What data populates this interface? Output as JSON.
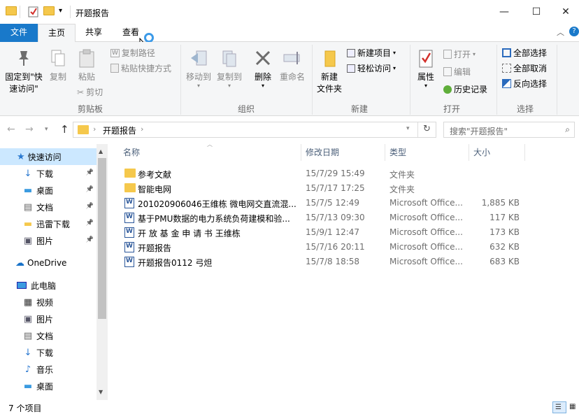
{
  "window": {
    "title": "开题报告"
  },
  "tabs": {
    "file": "文件",
    "home": "主页",
    "share": "共享",
    "view": "查看"
  },
  "ribbon": {
    "clipboard": {
      "pin_label": "固定到\"快\n速访问\"",
      "copy_label": "复制",
      "paste_label": "粘贴",
      "copy_path_label": "复制路径",
      "paste_shortcut_label": "粘贴快捷方式",
      "cut_label": "剪切",
      "group_label": "剪贴板"
    },
    "organize": {
      "move_to_label": "移动到",
      "copy_to_label": "复制到",
      "delete_label": "删除",
      "rename_label": "重命名",
      "group_label": "组织"
    },
    "new": {
      "new_folder_label": "新建\n文件夹",
      "new_item_label": "新建项目",
      "easy_access_label": "轻松访问",
      "group_label": "新建"
    },
    "open": {
      "properties_label": "属性",
      "open_label": "打开",
      "edit_label": "编辑",
      "history_label": "历史记录",
      "group_label": "打开"
    },
    "select": {
      "select_all_label": "全部选择",
      "select_none_label": "全部取消",
      "invert_label": "反向选择",
      "group_label": "选择"
    }
  },
  "address": {
    "path": "开题报告",
    "search_placeholder": "搜索\"开题报告\""
  },
  "nav": {
    "quick_access": "快速访问",
    "items": [
      {
        "label": "下载",
        "icon": "download-icon",
        "pinned": true
      },
      {
        "label": "桌面",
        "icon": "desktop-icon",
        "pinned": true
      },
      {
        "label": "文档",
        "icon": "documents-icon",
        "pinned": true
      },
      {
        "label": "迅雷下载",
        "icon": "folder-icon",
        "pinned": true
      },
      {
        "label": "图片",
        "icon": "pictures-icon",
        "pinned": true
      }
    ],
    "onedrive": "OneDrive",
    "this_pc": "此电脑",
    "pc_items": [
      {
        "label": "视频",
        "icon": "videos-icon"
      },
      {
        "label": "图片",
        "icon": "pictures-icon"
      },
      {
        "label": "文档",
        "icon": "documents-icon"
      },
      {
        "label": "下载",
        "icon": "download-icon"
      },
      {
        "label": "音乐",
        "icon": "music-icon"
      },
      {
        "label": "桌面",
        "icon": "desktop-icon"
      }
    ]
  },
  "columns": {
    "name": "名称",
    "modified": "修改日期",
    "type": "类型",
    "size": "大小"
  },
  "files": [
    {
      "name": "参考文献",
      "modified": "15/7/29 15:49",
      "type": "文件夹",
      "size": "",
      "kind": "folder"
    },
    {
      "name": "智能电网",
      "modified": "15/7/17 17:25",
      "type": "文件夹",
      "size": "",
      "kind": "folder"
    },
    {
      "name": "201020906046王维栋 微电网交直流混...",
      "modified": "15/7/5 12:49",
      "type": "Microsoft Office...",
      "size": "1,885 KB",
      "kind": "doc"
    },
    {
      "name": "基于PMU数据的电力系统负荷建模和验...",
      "modified": "15/7/13 09:30",
      "type": "Microsoft Office...",
      "size": "117 KB",
      "kind": "doc"
    },
    {
      "name": "开 放 基 金 申 请 书  王维栋",
      "modified": "15/9/1 12:47",
      "type": "Microsoft Office...",
      "size": "173 KB",
      "kind": "doc"
    },
    {
      "name": "开题报告",
      "modified": "15/7/16 20:11",
      "type": "Microsoft Office...",
      "size": "632 KB",
      "kind": "doc"
    },
    {
      "name": "开题报告0112 弓炟",
      "modified": "15/7/8 18:58",
      "type": "Microsoft Office...",
      "size": "683 KB",
      "kind": "doc"
    }
  ],
  "status": {
    "count": "7 个项目"
  },
  "colors": {
    "accent": "#1979ca",
    "folder": "#f5c84c",
    "header_text": "#4c607a"
  }
}
